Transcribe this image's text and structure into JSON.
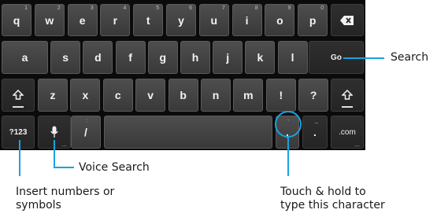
{
  "keyboard": {
    "row1": [
      {
        "label": "q",
        "hint": "1"
      },
      {
        "label": "w",
        "hint": "2"
      },
      {
        "label": "e",
        "hint": "3"
      },
      {
        "label": "r",
        "hint": "4"
      },
      {
        "label": "t",
        "hint": "5"
      },
      {
        "label": "y",
        "hint": "6"
      },
      {
        "label": "u",
        "hint": "7"
      },
      {
        "label": "i",
        "hint": "8"
      },
      {
        "label": "o",
        "hint": "9"
      },
      {
        "label": "p",
        "hint": "0"
      }
    ],
    "backspace_icon": "backspace-icon",
    "row2": [
      "a",
      "s",
      "d",
      "f",
      "g",
      "h",
      "j",
      "k",
      "l"
    ],
    "go_label": "Go",
    "shift_icon": "shift-icon",
    "row3": [
      "z",
      "x",
      "c",
      "v",
      "b",
      "n",
      "m",
      "!",
      "?"
    ],
    "row4": {
      "symbols_label": "?123",
      "mic_icon": "microphone-icon",
      "slash_label": "/",
      "slash_hint": ":",
      "dots": "...",
      "comma_label": ",",
      "comma_hint": "-",
      "period_label": ".",
      "period_hint": "_",
      "com_label": ".com"
    }
  },
  "annotations": {
    "search": "Search",
    "voice_search": "Voice Search",
    "insert_numbers_line1": "Insert numbers or",
    "insert_numbers_line2": "symbols",
    "touch_hold_line1": "Touch & hold to",
    "touch_hold_line2": "type this character"
  },
  "colors": {
    "keyboard_bg": "#0b0b0b",
    "key_bg": "#444444",
    "accent": "#1aa3df"
  }
}
